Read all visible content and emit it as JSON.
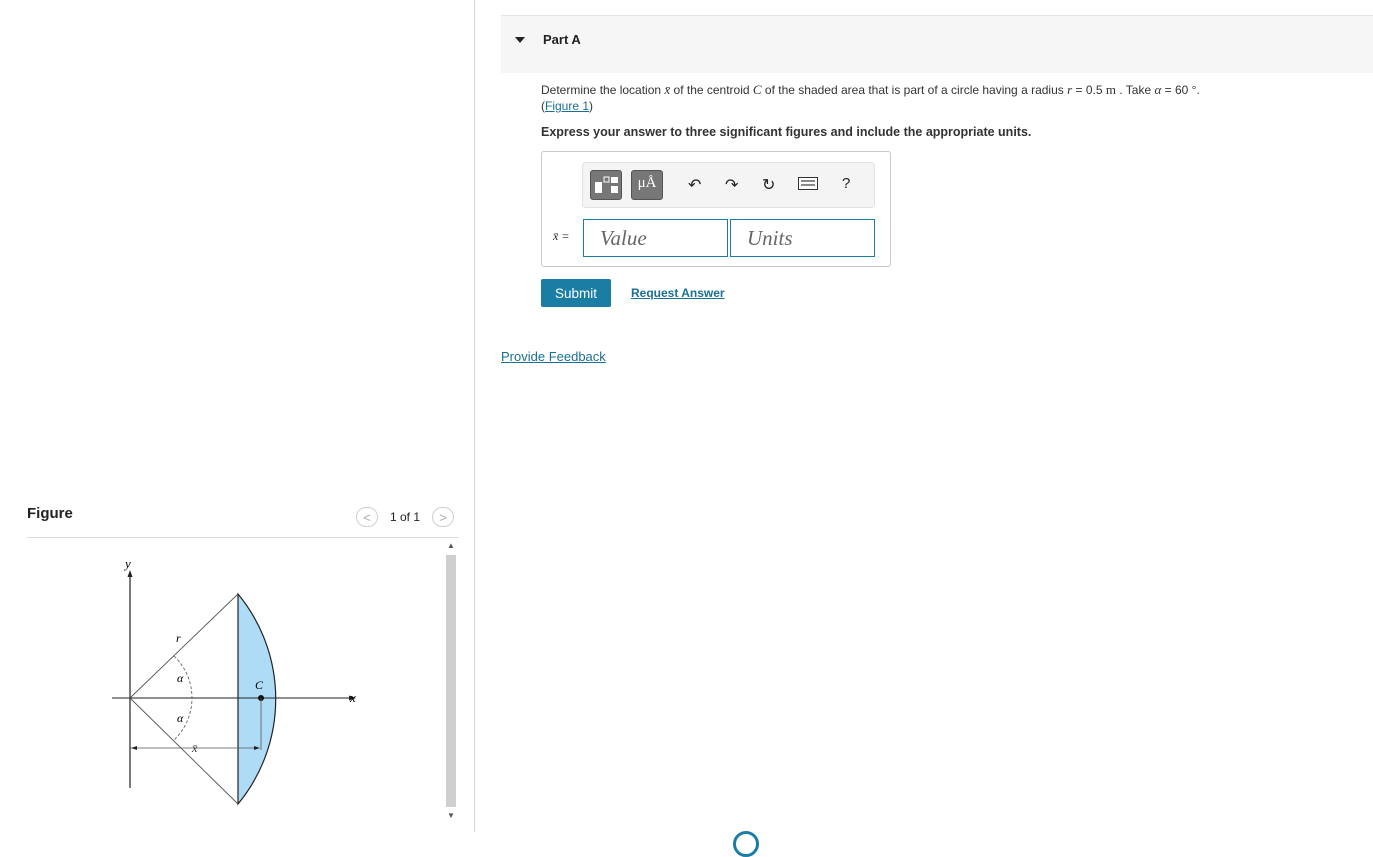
{
  "part": {
    "title": "Part A"
  },
  "question": {
    "text_before": "Determine the location ",
    "xbar": "x̄",
    "text_mid1": " of the centroid ",
    "C": "C",
    "text_mid2": " of the shaded area that is part of a circle having a radius ",
    "r": "r",
    "r_value": " = 0.5 ",
    "r_unit": "m",
    "text_take": " . Take ",
    "alpha": "α",
    "alpha_value": " = 60 °.",
    "figure_link": "Figure 1",
    "paren_open": "(",
    "paren_close": ")"
  },
  "instruction": "Express your answer to three significant figures and include the appropriate units.",
  "toolbar": {
    "units_btn": "μÅ",
    "help": "?"
  },
  "answer": {
    "label": "x̄ =",
    "value_placeholder": "Value",
    "units_placeholder": "Units"
  },
  "actions": {
    "submit": "Submit",
    "request_answer": "Request Answer",
    "feedback": "Provide Feedback"
  },
  "figure": {
    "title": "Figure",
    "pager": "1 of 1",
    "labels": {
      "y": "y",
      "x": "x",
      "r": "r",
      "alpha1": "α",
      "alpha2": "α",
      "C": "C",
      "xbar": "x̄"
    }
  }
}
